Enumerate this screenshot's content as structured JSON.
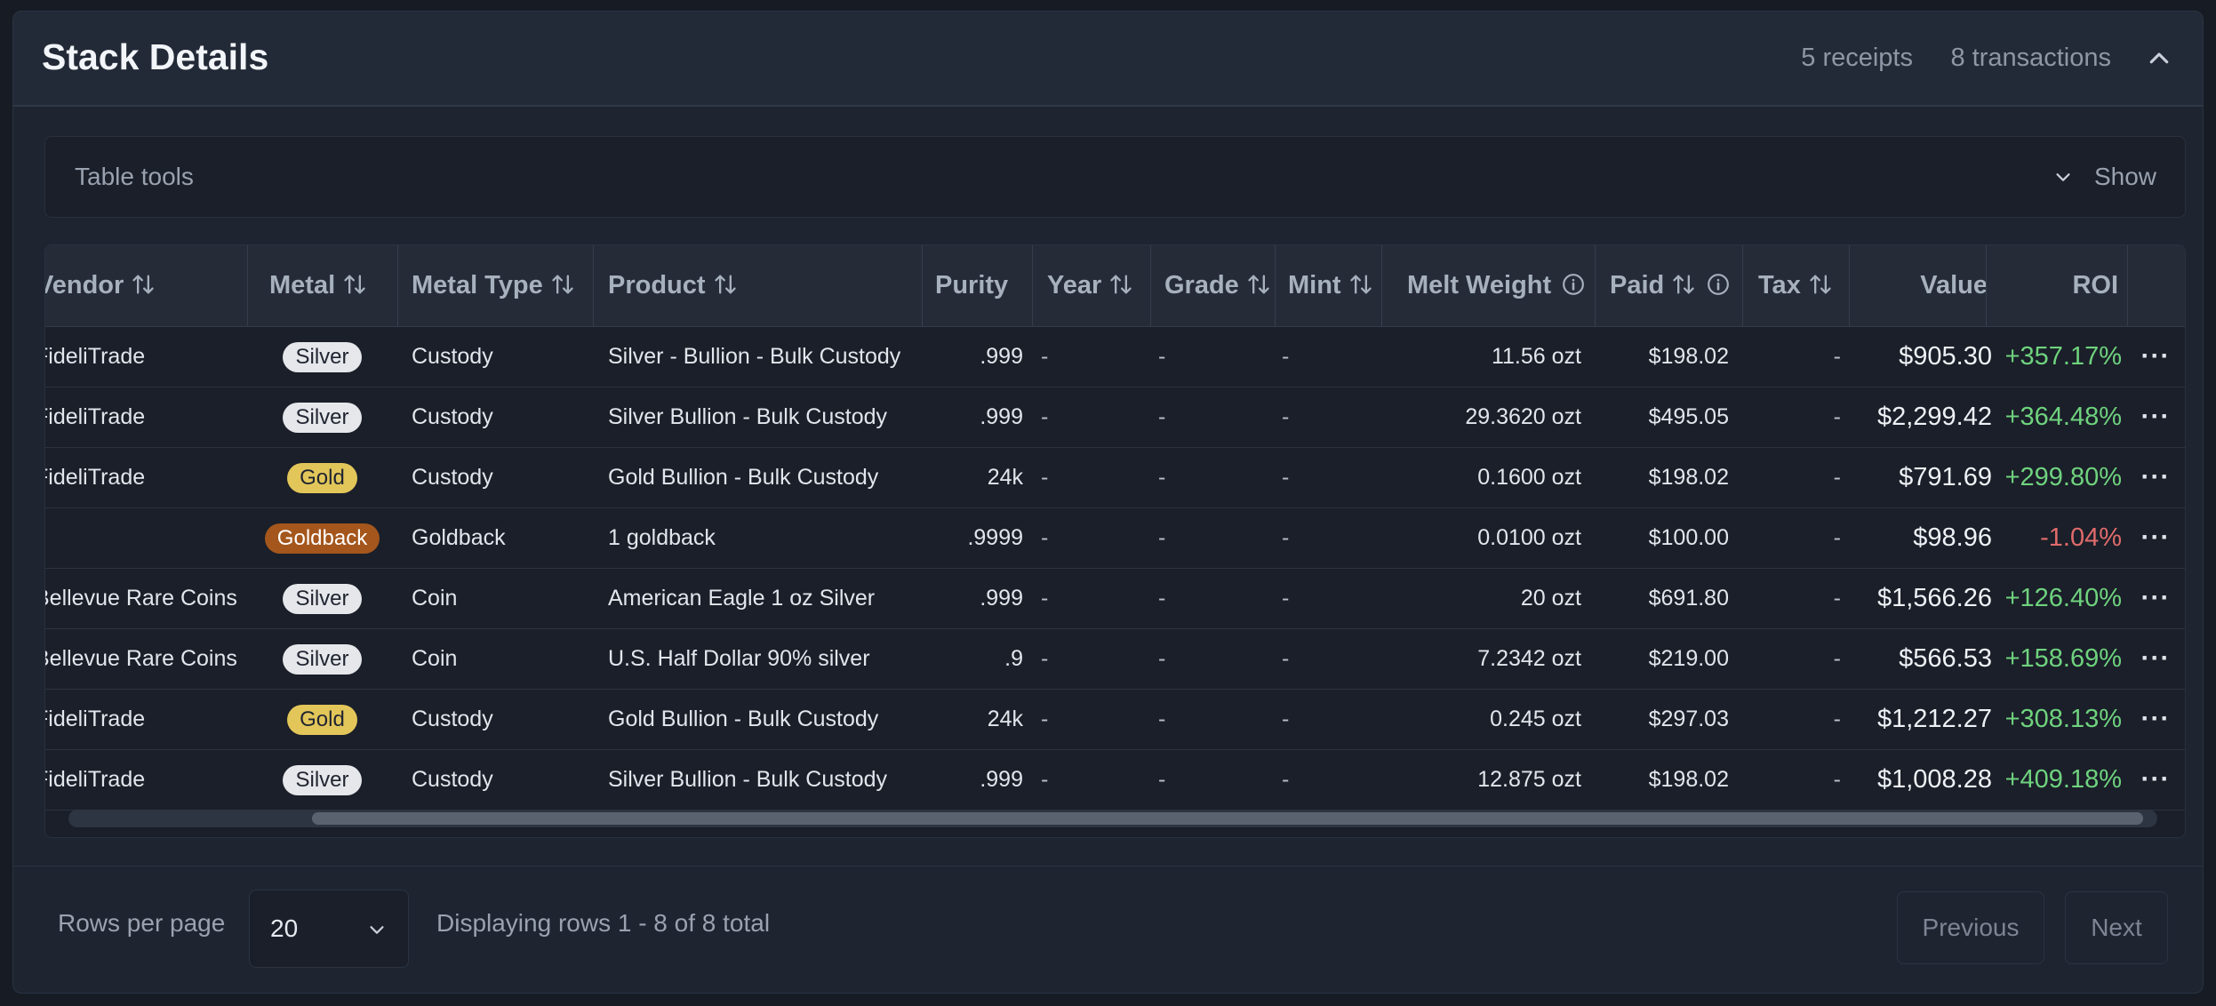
{
  "header": {
    "title": "Stack Details",
    "receipts": "5 receipts",
    "transactions": "8 transactions"
  },
  "tools": {
    "label": "Table tools",
    "toggle": "Show"
  },
  "columns": {
    "vendor": "Vendor",
    "metal": "Metal",
    "metal_type": "Metal Type",
    "product": "Product",
    "purity": "Purity",
    "year": "Year",
    "grade": "Grade",
    "mint": "Mint",
    "melt_weight": "Melt Weight",
    "paid": "Paid",
    "tax": "Tax",
    "value": "Value",
    "roi": "ROI"
  },
  "rows": [
    {
      "vendor": "FideliTrade",
      "metal": "Silver",
      "metal_type": "Custody",
      "product": "Silver - Bullion - Bulk Custody",
      "purity": ".999",
      "year": "-",
      "grade": "-",
      "mint": "-",
      "melt": "11.56 ozt",
      "paid": "$198.02",
      "tax": "-",
      "value": "$905.30",
      "roi": "+357.17%",
      "roi_color": "#6fd27e",
      "metal_bg": "#e5e7eb",
      "metal_fg": "#1f2430"
    },
    {
      "vendor": "FideliTrade",
      "metal": "Silver",
      "metal_type": "Custody",
      "product": "Silver Bullion - Bulk Custody",
      "purity": ".999",
      "year": "-",
      "grade": "-",
      "mint": "-",
      "melt": "29.3620 ozt",
      "paid": "$495.05",
      "tax": "-",
      "value": "$2,299.42",
      "roi": "+364.48%",
      "roi_color": "#6fd27e",
      "metal_bg": "#e5e7eb",
      "metal_fg": "#1f2430"
    },
    {
      "vendor": "FideliTrade",
      "metal": "Gold",
      "metal_type": "Custody",
      "product": "Gold Bullion - Bulk Custody",
      "purity": "24k",
      "year": "-",
      "grade": "-",
      "mint": "-",
      "melt": "0.1600 ozt",
      "paid": "$198.02",
      "tax": "-",
      "value": "$791.69",
      "roi": "+299.80%",
      "roi_color": "#6fd27e",
      "metal_bg": "#e3c65a",
      "metal_fg": "#1f2430"
    },
    {
      "vendor": "",
      "metal": "Goldback",
      "metal_type": "Goldback",
      "product": "1 goldback",
      "purity": ".9999",
      "year": "-",
      "grade": "-",
      "mint": "-",
      "melt": "0.0100 ozt",
      "paid": "$100.00",
      "tax": "-",
      "value": "$98.96",
      "roi": "-1.04%",
      "roi_color": "#e06b6b",
      "metal_bg": "#a4561c",
      "metal_fg": "#ffffff"
    },
    {
      "vendor": "Bellevue Rare Coins",
      "metal": "Silver",
      "metal_type": "Coin",
      "product": "American Eagle 1 oz Silver",
      "purity": ".999",
      "year": "-",
      "grade": "-",
      "mint": "-",
      "melt": "20 ozt",
      "paid": "$691.80",
      "tax": "-",
      "value": "$1,566.26",
      "roi": "+126.40%",
      "roi_color": "#6fd27e",
      "metal_bg": "#e5e7eb",
      "metal_fg": "#1f2430"
    },
    {
      "vendor": "Bellevue Rare Coins",
      "metal": "Silver",
      "metal_type": "Coin",
      "product": "U.S. Half Dollar 90% silver",
      "purity": ".9",
      "year": "-",
      "grade": "-",
      "mint": "-",
      "melt": "7.2342 ozt",
      "paid": "$219.00",
      "tax": "-",
      "value": "$566.53",
      "roi": "+158.69%",
      "roi_color": "#6fd27e",
      "metal_bg": "#e5e7eb",
      "metal_fg": "#1f2430"
    },
    {
      "vendor": "FideliTrade",
      "metal": "Gold",
      "metal_type": "Custody",
      "product": "Gold Bullion - Bulk Custody",
      "purity": "24k",
      "year": "-",
      "grade": "-",
      "mint": "-",
      "melt": "0.245 ozt",
      "paid": "$297.03",
      "tax": "-",
      "value": "$1,212.27",
      "roi": "+308.13%",
      "roi_color": "#6fd27e",
      "metal_bg": "#e3c65a",
      "metal_fg": "#1f2430"
    },
    {
      "vendor": "FideliTrade",
      "metal": "Silver",
      "metal_type": "Custody",
      "product": "Silver Bullion - Bulk Custody",
      "purity": ".999",
      "year": "-",
      "grade": "-",
      "mint": "-",
      "melt": "12.875 ozt",
      "paid": "$198.02",
      "tax": "-",
      "value": "$1,008.28",
      "roi": "+409.18%",
      "roi_color": "#6fd27e",
      "metal_bg": "#e5e7eb",
      "metal_fg": "#1f2430"
    }
  ],
  "footer": {
    "rows_per_page_label": "Rows per page",
    "rows_per_page": "20",
    "display_text": "Displaying rows 1 - 8 of 8 total",
    "prev": "Previous",
    "next": "Next"
  }
}
